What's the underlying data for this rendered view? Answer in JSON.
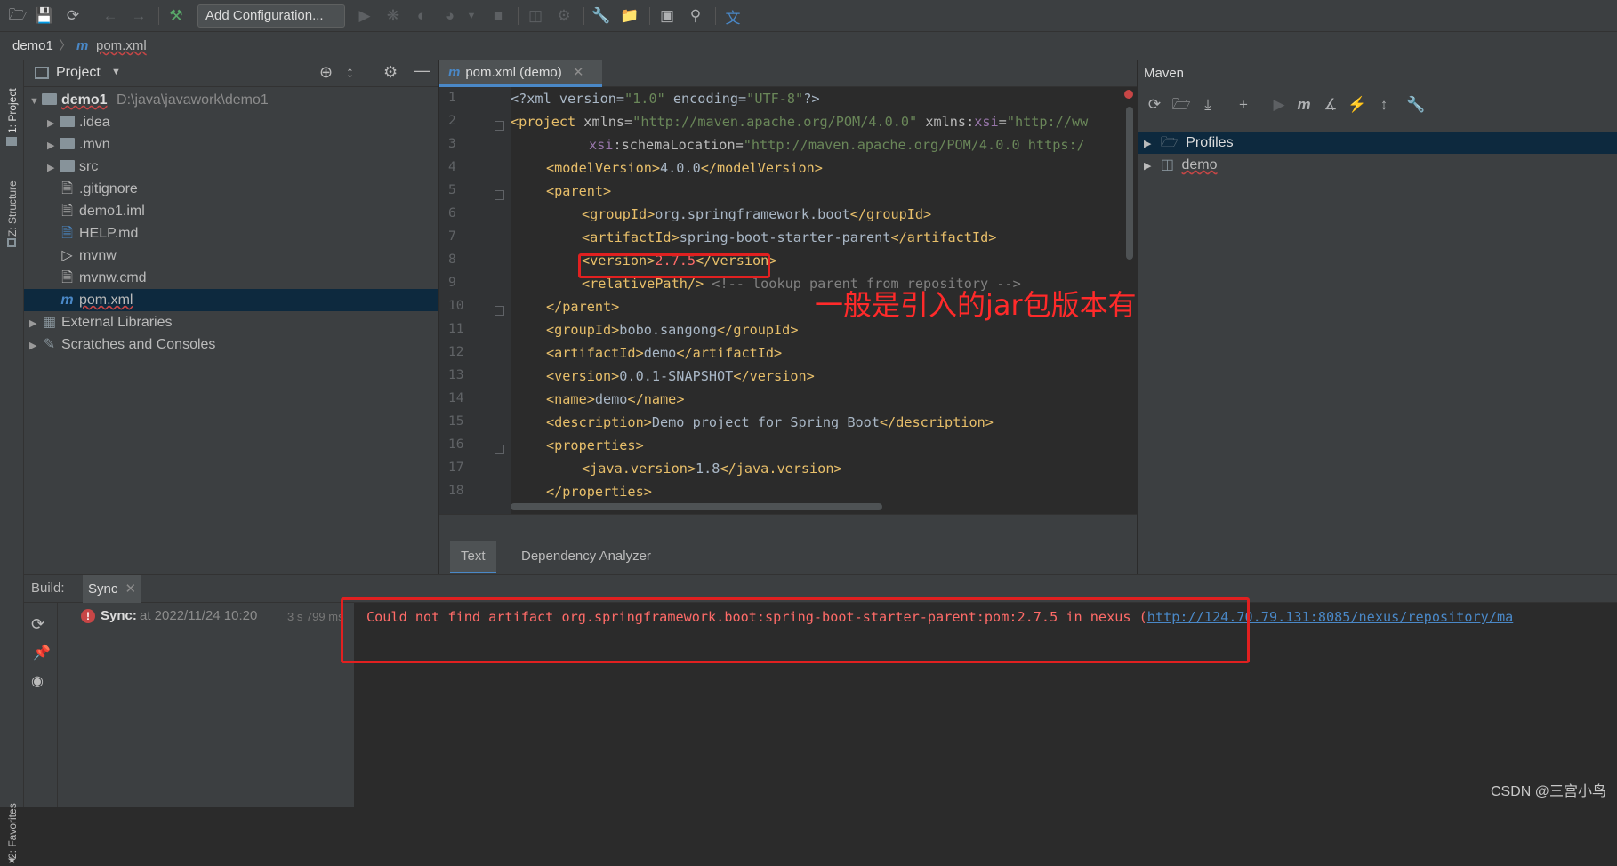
{
  "toolbar": {
    "add_configuration": "Add Configuration..."
  },
  "navbar": {
    "project": "demo1",
    "file": "pom.xml"
  },
  "left_strip": {
    "project_tab": "1: Project",
    "structure_tab": "Z: Structure",
    "favorites_tab": "2: Favorites"
  },
  "project_panel": {
    "title": "Project",
    "items": [
      {
        "label": "demo1",
        "path": "D:\\java\\javawork\\demo1"
      },
      {
        "label": ".idea"
      },
      {
        "label": ".mvn"
      },
      {
        "label": "src"
      },
      {
        "label": ".gitignore"
      },
      {
        "label": "demo1.iml"
      },
      {
        "label": "HELP.md"
      },
      {
        "label": "mvnw"
      },
      {
        "label": "mvnw.cmd"
      },
      {
        "label": "pom.xml"
      },
      {
        "label": "External Libraries"
      },
      {
        "label": "Scratches and Consoles"
      }
    ]
  },
  "editor": {
    "tab_label": "pom.xml (demo)",
    "line_numbers": [
      "1",
      "2",
      "3",
      "4",
      "5",
      "6",
      "7",
      "8",
      "9",
      "10",
      "11",
      "12",
      "13",
      "14",
      "15",
      "16",
      "17",
      "18"
    ],
    "lines": {
      "l1_a": "<?xml version=",
      "l1_b": "\"1.0\"",
      "l1_c": " encoding=",
      "l1_d": "\"UTF-8\"",
      "l1_e": "?>",
      "l2_a": "<project",
      "l2_b": " xmlns=",
      "l2_c": "\"http://maven.apache.org/POM/4.0.0\"",
      "l2_d": " xmlns:",
      "l2_e": "xsi",
      "l2_f": "=",
      "l2_g": "\"http://ww",
      "l3_a": "xsi",
      "l3_b": ":schemaLocation=",
      "l3_c": "\"http://maven.apache.org/POM/4.0.0 https:/",
      "l4_a": "<modelVersion>",
      "l4_b": "4.0.0",
      "l4_c": "</modelVersion>",
      "l5": "<parent>",
      "l6_a": "<groupId>",
      "l6_b": "org.springframework.boot",
      "l6_c": "</groupId>",
      "l7_a": "<artifactId>",
      "l7_b": "spring-boot-starter-parent",
      "l7_c": "</artifactId>",
      "l8_a": "<version>",
      "l8_b": "2.7.5",
      "l8_c": "</version>",
      "l9_a": "<relativePath/>",
      "l9_b": " <!-- lookup parent from repository -->",
      "l10": "</parent>",
      "l11_a": "<groupId>",
      "l11_b": "bobo.sangong",
      "l11_c": "</groupId>",
      "l12_a": "<artifactId>",
      "l12_b": "demo",
      "l12_c": "</artifactId>",
      "l13_a": "<version>",
      "l13_b": "0.0.1-SNAPSHOT",
      "l13_c": "</version>",
      "l14_a": "<name>",
      "l14_b": "demo",
      "l14_c": "</name>",
      "l15_a": "<description>",
      "l15_b": "Demo project for Spring Boot",
      "l15_c": "</description>",
      "l16": "<properties>",
      "l17_a": "<java.version>",
      "l17_b": "1.8",
      "l17_c": "</java.version>",
      "l18": "</properties>"
    },
    "bottom_tabs": [
      "Text",
      "Dependency Analyzer"
    ]
  },
  "maven": {
    "title": "Maven",
    "items": [
      "Profiles",
      "demo"
    ]
  },
  "build": {
    "label": "Build:",
    "tab": "Sync",
    "sync_label": "Sync:",
    "sync_time": "at 2022/11/24 10:20",
    "duration": "3 s 799 ms",
    "error_text": "Could not find artifact org.springframework.boot:spring-boot-starter-parent:pom:2.7.5 in nexus (",
    "error_link": "http://124.70.79.131:8085/nexus/repository/ma"
  },
  "annotation": "一般是引入的jar包版本有问题，更改版本即可",
  "watermark": "CSDN @三宫小鸟",
  "colors": {
    "annotation_red": "#ff2a2a",
    "selection": "#0d293e",
    "accent": "#4a88c7"
  }
}
